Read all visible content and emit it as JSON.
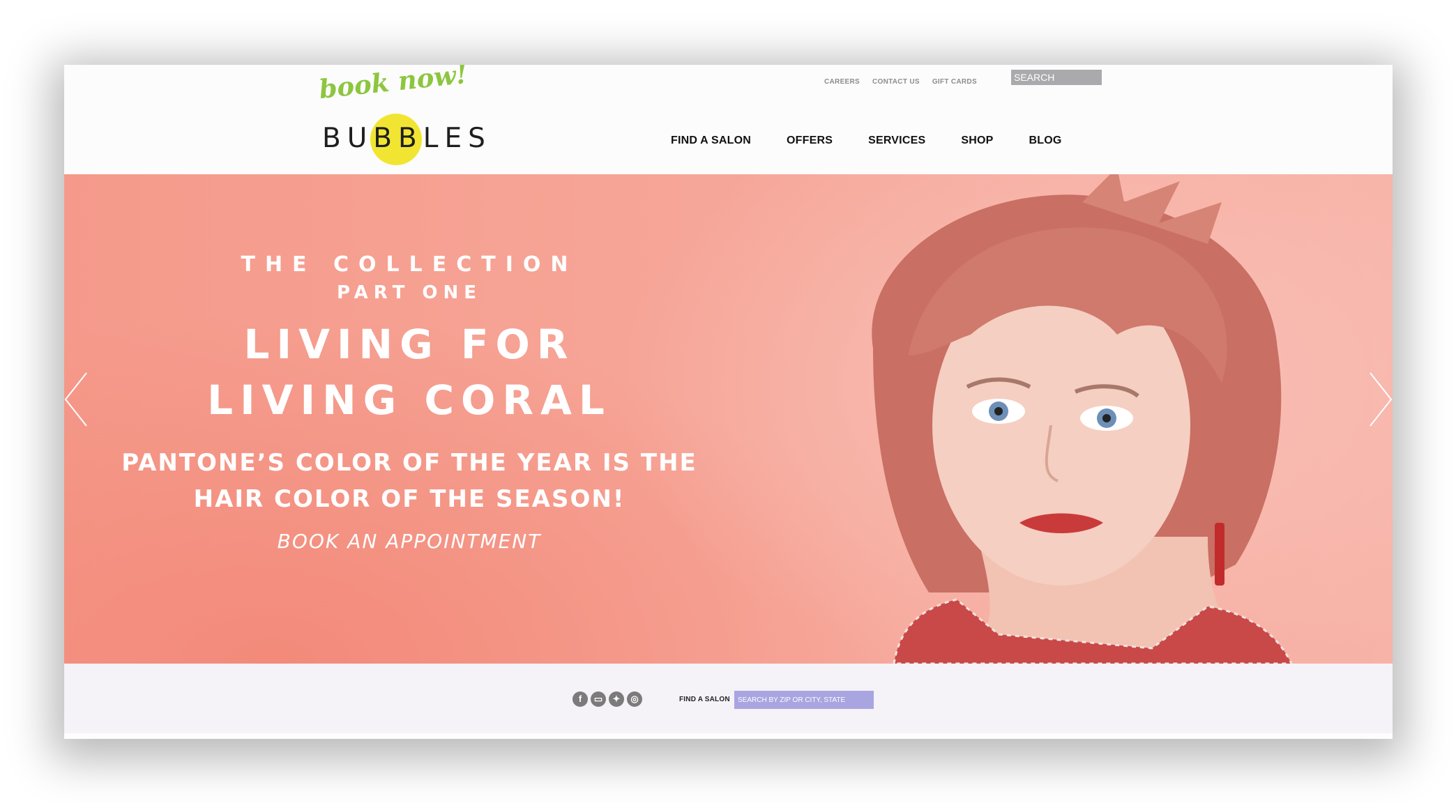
{
  "header": {
    "book_now": "book now!",
    "logo_text": "BUBBLES",
    "utility_links": [
      "CAREERS",
      "CONTACT US",
      "GIFT CARDS"
    ],
    "search_value": "SEARCH",
    "nav": [
      "FIND A SALON",
      "OFFERS",
      "SERVICES",
      "SHOP",
      "BLOG"
    ]
  },
  "hero": {
    "eyebrow_line1": "THE COLLECTION",
    "eyebrow_line2": "PART ONE",
    "headline_line1": "LIVING FOR",
    "headline_line2": "LIVING CORAL",
    "subhead_line1": "PANTONE’S COLOR OF THE YEAR IS THE",
    "subhead_line2": "HAIR COLOR OF THE SEASON!",
    "cta": "BOOK AN APPOINTMENT"
  },
  "footer": {
    "social_icons": [
      "facebook-icon",
      "youtube-icon",
      "twitter-icon",
      "instagram-icon"
    ],
    "find_label": "FIND A SALON",
    "find_placeholder": "SEARCH BY ZIP OR CITY, STATE"
  },
  "colors": {
    "accent_green": "#8cc63f",
    "logo_yellow": "#f2e532",
    "coral": "#f59a8b",
    "footer_input": "#a9a5e0"
  }
}
